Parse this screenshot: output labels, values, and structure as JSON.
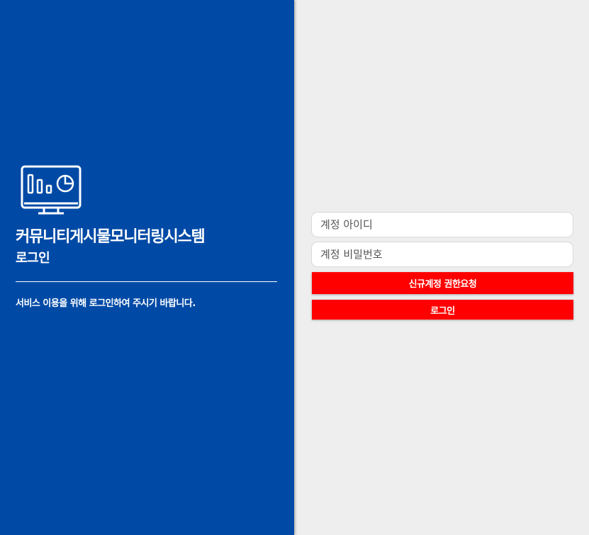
{
  "branding": {
    "icon": "monitor-chart-icon",
    "system_title": "커뮤니티게시물모니터링시스템",
    "page_subtitle": "로그인",
    "notice": "서비스 이용을 위해 로그인하여 주시기 바랍니다."
  },
  "login_form": {
    "id_placeholder": "계정 아이디",
    "password_placeholder": "계정 비밀번호",
    "request_button_label": "신규계정 권한요청",
    "login_button_label": "로그인"
  },
  "colors": {
    "left_panel_bg": "#004aa6",
    "right_panel_bg": "#eeeeee",
    "button_bg": "#ff0000",
    "text_on_dark": "#ffffff"
  }
}
